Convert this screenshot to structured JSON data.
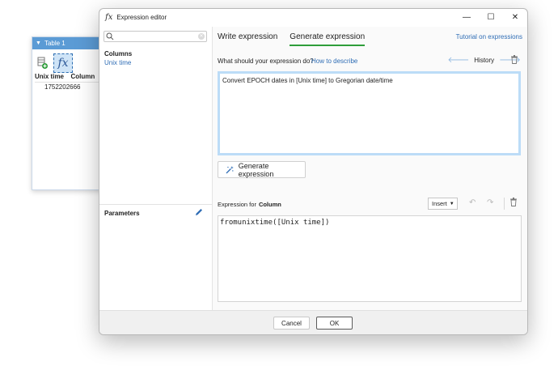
{
  "table_window": {
    "title": "Table 1",
    "columns": [
      "Unix time",
      "Column"
    ],
    "rows": [
      [
        "1752202666",
        ""
      ]
    ]
  },
  "dialog": {
    "title": "Expression editor",
    "left": {
      "search_placeholder": "",
      "columns_heading": "Columns",
      "columns": [
        "Unix time"
      ],
      "parameters_heading": "Parameters"
    },
    "tabs": [
      {
        "label": "Write expression",
        "active": false
      },
      {
        "label": "Generate expression",
        "active": true
      }
    ],
    "tutorial_link": "Tutorial on expressions",
    "question": "What should your expression do?",
    "how_link": "How to describe",
    "history_label": "History",
    "prompt_text": "Convert EPOCH dates in [Unix time] to Gregorian date/time",
    "generate_button": "Generate expression",
    "expression_for_label": "Expression for",
    "expression_for_target": "Column",
    "insert_label": "Insert",
    "expression": "fromunixtime([Unix time])",
    "cancel": "Cancel",
    "ok": "OK"
  },
  "colors": {
    "accent": "#2e9e3a",
    "link": "#2f6db5",
    "titlebar": "#5b9bd5",
    "prompt_border": "#bcdcf7"
  }
}
